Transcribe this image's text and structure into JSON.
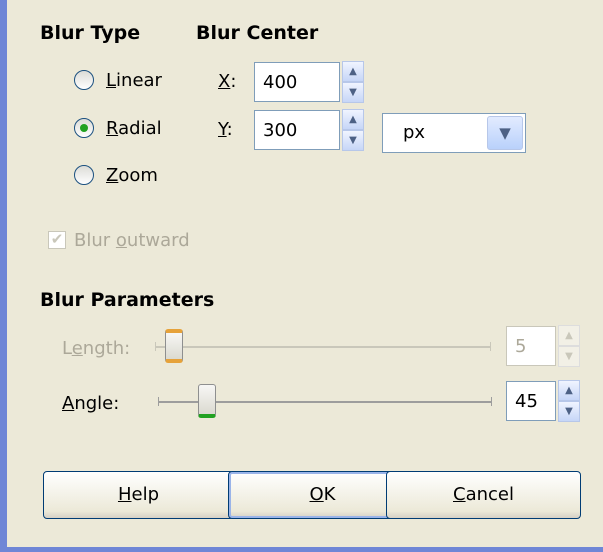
{
  "blur_type": {
    "heading": "Blur Type",
    "options": [
      {
        "label_mn": "L",
        "label_rest": "inear",
        "checked": false
      },
      {
        "label_mn": "R",
        "label_rest": "adial",
        "checked": true
      },
      {
        "label_mn": "Z",
        "label_rest": "oom",
        "checked": false
      }
    ]
  },
  "blur_center": {
    "heading": "Blur Center",
    "x_label_mn": "X",
    "x_label_rest": ":",
    "x_value": "400",
    "y_label_mn": "Y",
    "y_label_rest": ":",
    "y_value": "300",
    "unit": "px"
  },
  "blur_outward": {
    "label_pre": "Blur ",
    "label_mn": "o",
    "label_rest": "utward",
    "checked": true,
    "enabled": false
  },
  "blur_parameters": {
    "heading": "Blur Parameters",
    "length": {
      "label_pre": "L",
      "label_mn": "e",
      "label_rest": "ngth:",
      "value": "5",
      "enabled": false
    },
    "angle": {
      "label_mn": "A",
      "label_rest": "ngle:",
      "value": "45",
      "enabled": true
    }
  },
  "buttons": {
    "help": {
      "mn": "H",
      "rest": "elp"
    },
    "ok": {
      "mn": "O",
      "rest": "K"
    },
    "cancel": {
      "mn": "C",
      "rest": "ancel"
    }
  },
  "colors": {
    "frame_accent": "#6f86d6",
    "background": "#ece9d8",
    "radio_checked": "#21a121",
    "disabled_text": "#aca899"
  }
}
